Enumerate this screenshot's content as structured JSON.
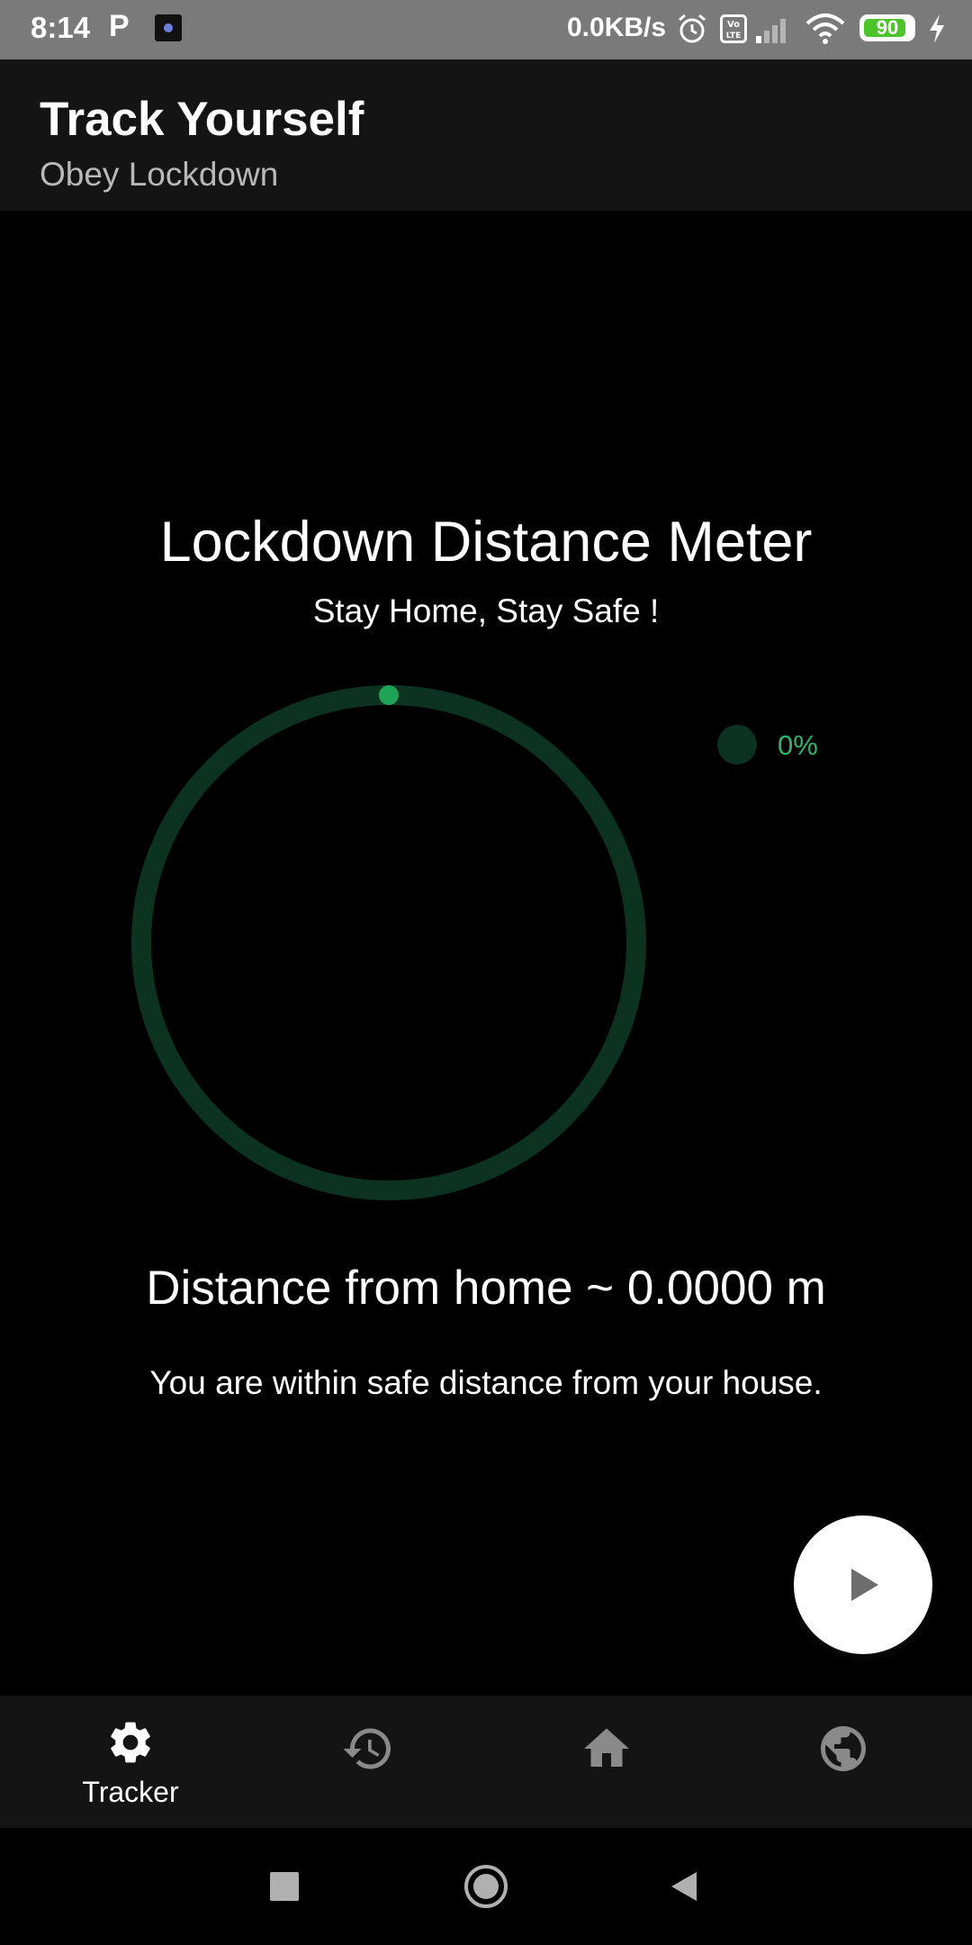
{
  "status_bar": {
    "time": "8:14",
    "notification_p": "P",
    "net_speed": "0.0KB/s",
    "battery_level": "90",
    "battery_percent": 90
  },
  "app_bar": {
    "title": "Track Yourself",
    "subtitle": "Obey Lockdown"
  },
  "meter": {
    "title": "Lockdown Distance Meter",
    "subtitle": "Stay Home, Stay Safe !",
    "progress_percent": 0,
    "legend_label": "0%",
    "track_color": "#0b3320",
    "progress_color": "#1fa356"
  },
  "distance": {
    "text": "Distance from home ~ 0.0000 m",
    "status": "You are within safe distance from your house."
  },
  "fab": {
    "icon": "play-icon"
  },
  "bottom_nav": {
    "items": [
      {
        "icon": "settings-gear-icon",
        "label": "Tracker",
        "active": true
      },
      {
        "icon": "history-icon",
        "label": "",
        "active": false
      },
      {
        "icon": "home-icon",
        "label": "",
        "active": false
      },
      {
        "icon": "globe-icon",
        "label": "",
        "active": false
      }
    ]
  },
  "system_nav": {
    "icons": [
      "recents-square-icon",
      "home-circle-icon",
      "back-triangle-icon"
    ]
  }
}
